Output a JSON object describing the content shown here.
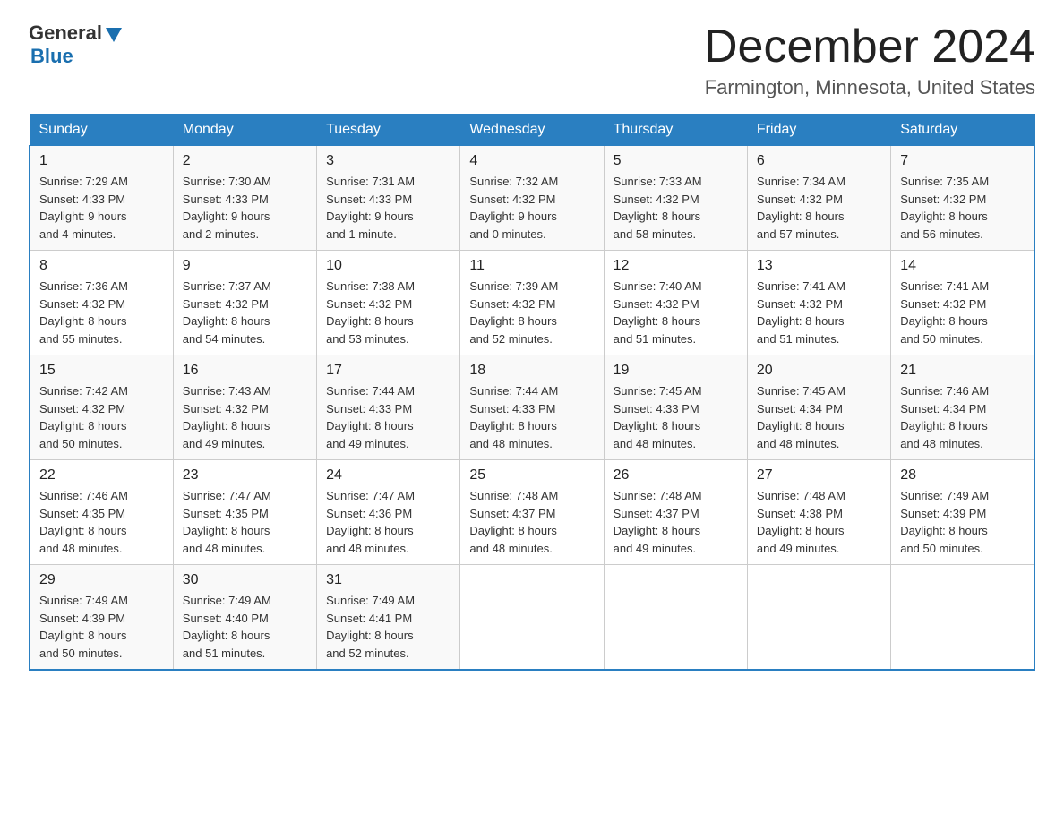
{
  "header": {
    "logo_general": "General",
    "logo_blue": "Blue",
    "month_title": "December 2024",
    "location": "Farmington, Minnesota, United States"
  },
  "days_of_week": [
    "Sunday",
    "Monday",
    "Tuesday",
    "Wednesday",
    "Thursday",
    "Friday",
    "Saturday"
  ],
  "weeks": [
    [
      {
        "day": "1",
        "sunrise": "7:29 AM",
        "sunset": "4:33 PM",
        "daylight": "9 hours and 4 minutes."
      },
      {
        "day": "2",
        "sunrise": "7:30 AM",
        "sunset": "4:33 PM",
        "daylight": "9 hours and 2 minutes."
      },
      {
        "day": "3",
        "sunrise": "7:31 AM",
        "sunset": "4:33 PM",
        "daylight": "9 hours and 1 minute."
      },
      {
        "day": "4",
        "sunrise": "7:32 AM",
        "sunset": "4:32 PM",
        "daylight": "9 hours and 0 minutes."
      },
      {
        "day": "5",
        "sunrise": "7:33 AM",
        "sunset": "4:32 PM",
        "daylight": "8 hours and 58 minutes."
      },
      {
        "day": "6",
        "sunrise": "7:34 AM",
        "sunset": "4:32 PM",
        "daylight": "8 hours and 57 minutes."
      },
      {
        "day": "7",
        "sunrise": "7:35 AM",
        "sunset": "4:32 PM",
        "daylight": "8 hours and 56 minutes."
      }
    ],
    [
      {
        "day": "8",
        "sunrise": "7:36 AM",
        "sunset": "4:32 PM",
        "daylight": "8 hours and 55 minutes."
      },
      {
        "day": "9",
        "sunrise": "7:37 AM",
        "sunset": "4:32 PM",
        "daylight": "8 hours and 54 minutes."
      },
      {
        "day": "10",
        "sunrise": "7:38 AM",
        "sunset": "4:32 PM",
        "daylight": "8 hours and 53 minutes."
      },
      {
        "day": "11",
        "sunrise": "7:39 AM",
        "sunset": "4:32 PM",
        "daylight": "8 hours and 52 minutes."
      },
      {
        "day": "12",
        "sunrise": "7:40 AM",
        "sunset": "4:32 PM",
        "daylight": "8 hours and 51 minutes."
      },
      {
        "day": "13",
        "sunrise": "7:41 AM",
        "sunset": "4:32 PM",
        "daylight": "8 hours and 51 minutes."
      },
      {
        "day": "14",
        "sunrise": "7:41 AM",
        "sunset": "4:32 PM",
        "daylight": "8 hours and 50 minutes."
      }
    ],
    [
      {
        "day": "15",
        "sunrise": "7:42 AM",
        "sunset": "4:32 PM",
        "daylight": "8 hours and 50 minutes."
      },
      {
        "day": "16",
        "sunrise": "7:43 AM",
        "sunset": "4:32 PM",
        "daylight": "8 hours and 49 minutes."
      },
      {
        "day": "17",
        "sunrise": "7:44 AM",
        "sunset": "4:33 PM",
        "daylight": "8 hours and 49 minutes."
      },
      {
        "day": "18",
        "sunrise": "7:44 AM",
        "sunset": "4:33 PM",
        "daylight": "8 hours and 48 minutes."
      },
      {
        "day": "19",
        "sunrise": "7:45 AM",
        "sunset": "4:33 PM",
        "daylight": "8 hours and 48 minutes."
      },
      {
        "day": "20",
        "sunrise": "7:45 AM",
        "sunset": "4:34 PM",
        "daylight": "8 hours and 48 minutes."
      },
      {
        "day": "21",
        "sunrise": "7:46 AM",
        "sunset": "4:34 PM",
        "daylight": "8 hours and 48 minutes."
      }
    ],
    [
      {
        "day": "22",
        "sunrise": "7:46 AM",
        "sunset": "4:35 PM",
        "daylight": "8 hours and 48 minutes."
      },
      {
        "day": "23",
        "sunrise": "7:47 AM",
        "sunset": "4:35 PM",
        "daylight": "8 hours and 48 minutes."
      },
      {
        "day": "24",
        "sunrise": "7:47 AM",
        "sunset": "4:36 PM",
        "daylight": "8 hours and 48 minutes."
      },
      {
        "day": "25",
        "sunrise": "7:48 AM",
        "sunset": "4:37 PM",
        "daylight": "8 hours and 48 minutes."
      },
      {
        "day": "26",
        "sunrise": "7:48 AM",
        "sunset": "4:37 PM",
        "daylight": "8 hours and 49 minutes."
      },
      {
        "day": "27",
        "sunrise": "7:48 AM",
        "sunset": "4:38 PM",
        "daylight": "8 hours and 49 minutes."
      },
      {
        "day": "28",
        "sunrise": "7:49 AM",
        "sunset": "4:39 PM",
        "daylight": "8 hours and 50 minutes."
      }
    ],
    [
      {
        "day": "29",
        "sunrise": "7:49 AM",
        "sunset": "4:39 PM",
        "daylight": "8 hours and 50 minutes."
      },
      {
        "day": "30",
        "sunrise": "7:49 AM",
        "sunset": "4:40 PM",
        "daylight": "8 hours and 51 minutes."
      },
      {
        "day": "31",
        "sunrise": "7:49 AM",
        "sunset": "4:41 PM",
        "daylight": "8 hours and 52 minutes."
      },
      null,
      null,
      null,
      null
    ]
  ],
  "labels": {
    "sunrise": "Sunrise:",
    "sunset": "Sunset:",
    "daylight": "Daylight:"
  }
}
